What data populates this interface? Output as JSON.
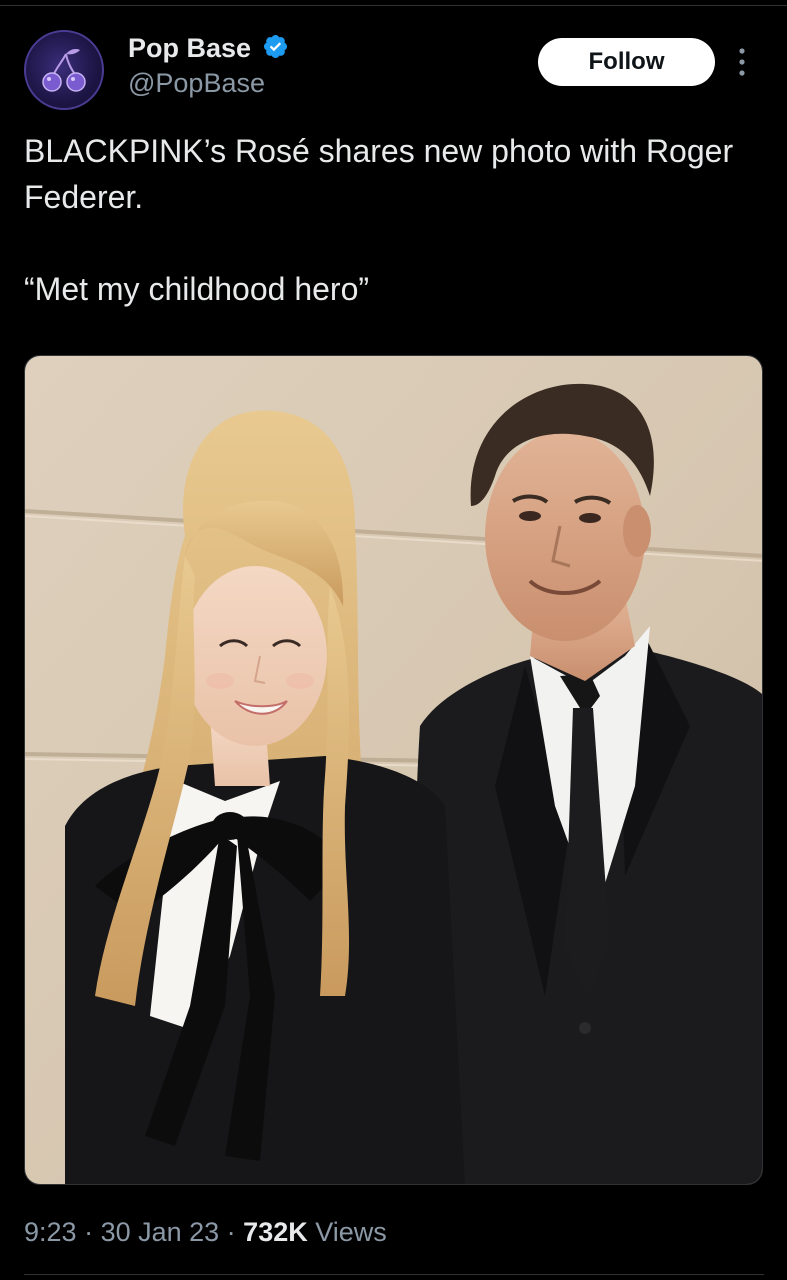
{
  "author": {
    "display_name": "Pop Base",
    "handle": "@PopBase",
    "verified": true,
    "avatar_icon": "cherry-icon",
    "accent_color": "#1d9bf0"
  },
  "actions": {
    "follow_label": "Follow",
    "more_icon": "more-vertical-icon"
  },
  "tweet": {
    "paragraphs": [
      "BLACKPINK’s Rosé shares new photo with Roger Federer.",
      "“Met my childhood hero”"
    ]
  },
  "meta": {
    "time": "9:23",
    "separator": " · ",
    "date": "30 Jan 23",
    "views_count": "732K",
    "views_label": "Views"
  }
}
